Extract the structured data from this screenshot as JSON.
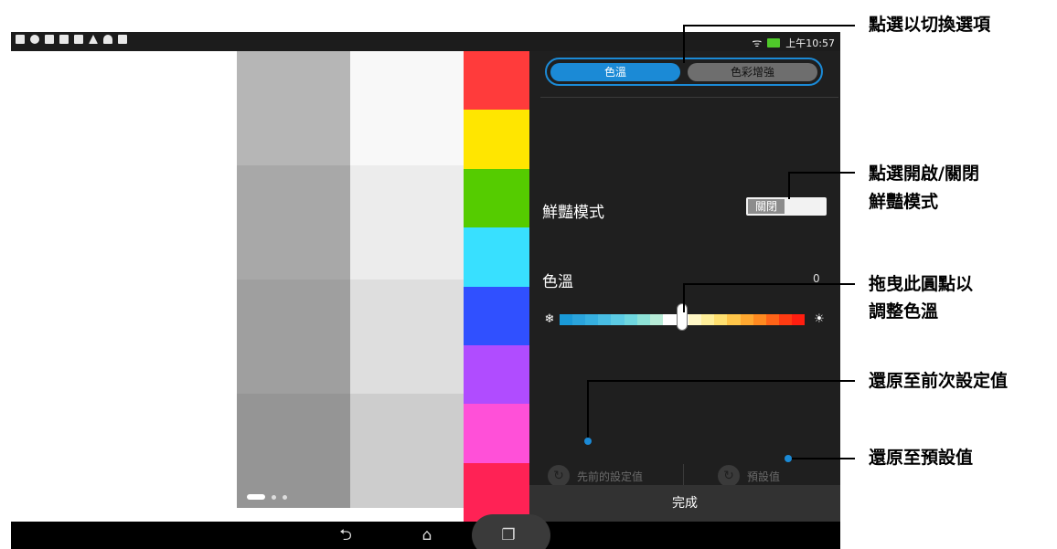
{
  "status": {
    "time": "上午10:57"
  },
  "tabs": [
    {
      "label": "色溫",
      "active": true
    },
    {
      "label": "色彩增強",
      "active": false
    }
  ],
  "vivid_mode": {
    "label": "鮮豔模式",
    "toggle_state": "關閉"
  },
  "color_temp": {
    "label": "色溫",
    "value": "0",
    "level": 0.5
  },
  "reset": {
    "previous_label": "先前的設定值",
    "default_label": "預設值"
  },
  "done_label": "完成",
  "callouts": {
    "tabs": "點選以切換選項",
    "toggle_line1": "點選開啟/關閉",
    "toggle_line2": "鮮豔模式",
    "slider_line1": "拖曳此圓點以",
    "slider_line2": "調整色溫",
    "previous": "還原至前次設定值",
    "default": "還原至預設值"
  },
  "colors": {
    "accent": "#1b8ad6",
    "panel_bg": "#1f1f1f",
    "gray_col1": [
      "#b6b6b6",
      "#a8a8a8",
      "#9f9f9f",
      "#959595"
    ],
    "gray_col2": [
      "#f8f8f8",
      "#ececec",
      "#dedede",
      "#cdcdcd"
    ],
    "color_col": [
      "#ff3b3b",
      "#ffe600",
      "#55cc00",
      "#38e0ff",
      "#3050ff",
      "#b04cff",
      "#ff50d8",
      "#ff2255"
    ],
    "slider": [
      "#1a9ad8",
      "#2aa4dc",
      "#36b0e0",
      "#48bde3",
      "#5ccbe4",
      "#6fd7df",
      "#8ee2d7",
      "#b8ecd8",
      "#ffffff",
      "#ffffff",
      "#fff7c6",
      "#ffef9a",
      "#ffe070",
      "#ffc64a",
      "#ffa830",
      "#ff8a20",
      "#ff6418",
      "#ff3b12",
      "#ff1e10"
    ]
  }
}
